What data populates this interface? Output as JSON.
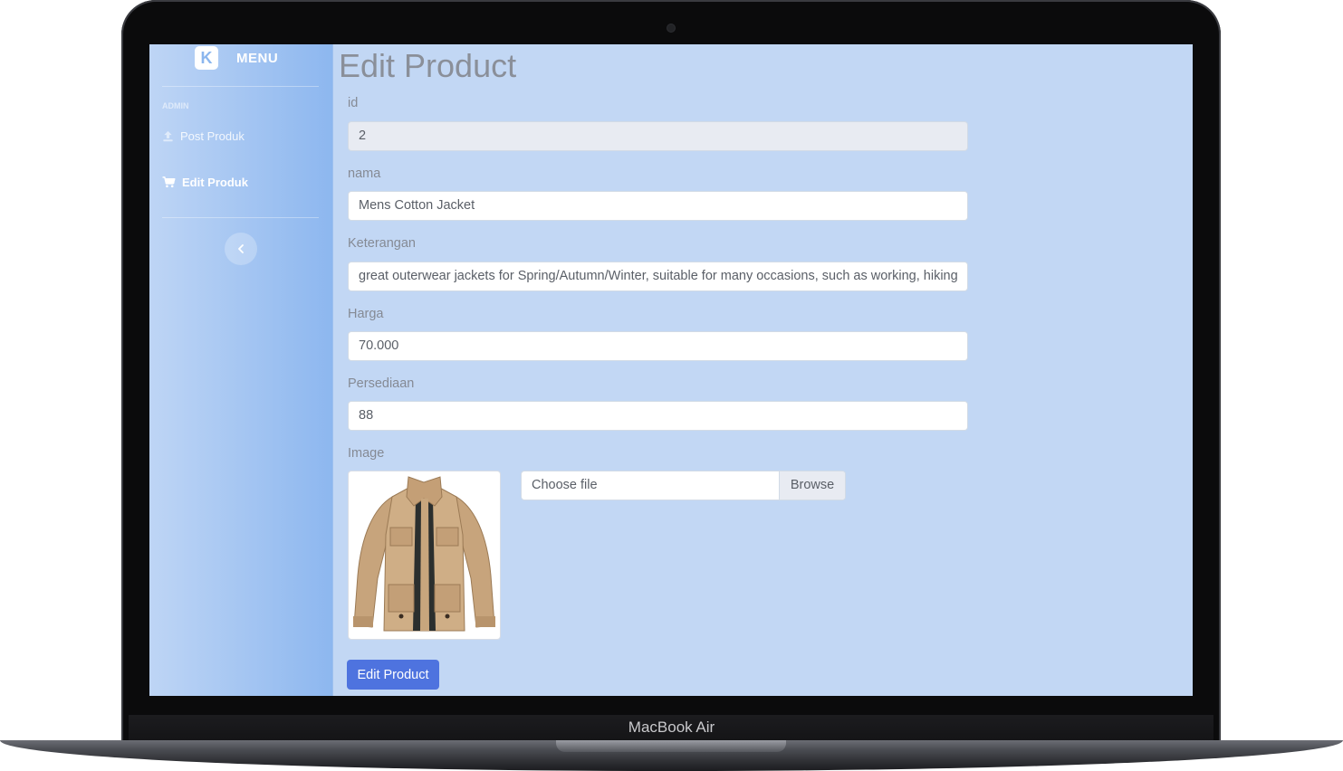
{
  "device": {
    "brand_label": "MacBook Air"
  },
  "sidebar": {
    "logo_letter": "K",
    "menu_label": "MENU",
    "section_heading": "ADMIN",
    "items": [
      {
        "label": "Post Produk",
        "icon": "upload-icon",
        "active": false
      },
      {
        "label": "Edit Produk",
        "icon": "cart-icon",
        "active": true
      }
    ],
    "toggle_icon": "chevron-left-icon"
  },
  "form": {
    "title": "Edit Product",
    "fields": {
      "id": {
        "label": "id",
        "value": "2"
      },
      "nama": {
        "label": "nama",
        "value": "Mens Cotton Jacket"
      },
      "keterangan": {
        "label": "Keterangan",
        "value": "great outerwear jackets for Spring/Autumn/Winter, suitable for many occasions, such as working, hiking"
      },
      "harga": {
        "label": "Harga",
        "value": "70.000"
      },
      "persediaan": {
        "label": "Persediaan",
        "value": "88"
      }
    },
    "image": {
      "label": "Image",
      "file_placeholder": "Choose file",
      "browse_label": "Browse"
    },
    "submit_label": "Edit Product"
  },
  "colors": {
    "screen_bg": "#c2d7f4",
    "sidebar_gradient_start": "#bed5f5",
    "sidebar_gradient_end": "#8db7ef",
    "primary_button": "#4e73df",
    "jacket": "#c9a983"
  }
}
